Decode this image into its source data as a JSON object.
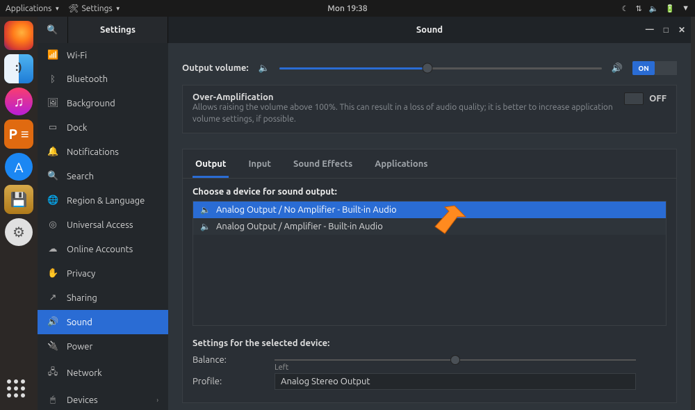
{
  "topbar": {
    "applications": "Applications",
    "open_app": "Settings",
    "clock": "Mon 19:38"
  },
  "window": {
    "sidebar_title": "Settings",
    "title": "Sound",
    "minimize": "—",
    "maximize": "□",
    "close": "✕"
  },
  "sidebar": {
    "items": [
      {
        "icon": "📶",
        "label": "Wi-Fi"
      },
      {
        "icon": "ᛒ",
        "label": "Bluetooth"
      },
      {
        "icon": "🖼",
        "label": "Background"
      },
      {
        "icon": "▭",
        "label": "Dock"
      },
      {
        "icon": "🔔",
        "label": "Notifications"
      },
      {
        "icon": "🔍",
        "label": "Search"
      },
      {
        "icon": "🌐",
        "label": "Region & Language"
      },
      {
        "icon": "◎",
        "label": "Universal Access"
      },
      {
        "icon": "☁",
        "label": "Online Accounts"
      },
      {
        "icon": "✋",
        "label": "Privacy"
      },
      {
        "icon": "↗",
        "label": "Sharing"
      },
      {
        "icon": "🔊",
        "label": "Sound"
      },
      {
        "icon": "🔌",
        "label": "Power"
      },
      {
        "icon": "🖧",
        "label": "Network"
      },
      {
        "icon": "🖱",
        "label": "Devices"
      }
    ]
  },
  "sound": {
    "output_volume_label": "Output volume:",
    "switch_on": "ON",
    "switch_off": "OFF",
    "overamp_title": "Over-Amplification",
    "overamp_desc": "Allows raising the volume above 100%. This can result in a loss of audio quality; it is better to increase application volume settings, if possible.",
    "tabs": [
      "Output",
      "Input",
      "Sound Effects",
      "Applications"
    ],
    "choose_label": "Choose a device for sound output:",
    "devices": [
      "Analog Output / No Amplifier - Built-in Audio",
      "Analog Output / Amplifier - Built-in Audio"
    ],
    "settings_for_label": "Settings for the selected device:",
    "balance_label": "Balance:",
    "balance_left": "Left",
    "profile_label": "Profile:",
    "profile_value": "Analog Stereo Output"
  }
}
